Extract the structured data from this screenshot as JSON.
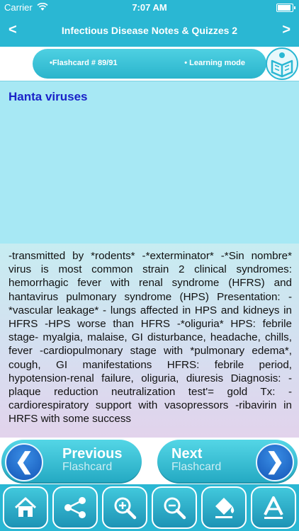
{
  "status_bar": {
    "carrier": "Carrier",
    "time": "7:07 AM"
  },
  "nav": {
    "title": "Infectious Disease Notes & Quizzes 2",
    "back_glyph": "<",
    "forward_glyph": ">"
  },
  "info": {
    "flashcard": "•Flashcard #  89/91",
    "mode": "• Learning mode"
  },
  "card": {
    "title": "Hanta viruses",
    "body": "-transmitted by *rodents* -*exterminator* -*Sin nombre* virus is most common strain   2 clinical syndromes: hemorrhagic fever with renal syndrome (HFRS) and hantavirus pulmonary syndrome (HPS)  Presentation: -*vascular leakage* - lungs affected in HPS and kidneys in HFRS -HPS worse than HFRS -*oliguria*  HPS: febrile stage- myalgia, malaise, GI disturbance, headache, chills, fever -cardiopulmonary stage with *pulmonary edema*, cough, GI manifestations  HFRS: febrile period, hypotension-renal failure, oliguria, diuresis    Diagnosis: -plaque reduction neutralization test'= gold    Tx: -cardiorespiratory support with vasopressors -ribavirin in HRFS with some success"
  },
  "navigation": {
    "prev_line1": "Previous",
    "prev_line2": "Flashcard",
    "next_line1": "Next",
    "next_line2": "Flashcard"
  },
  "toolbar": {
    "icons": [
      "home-icon",
      "share-icon",
      "zoom-in-icon",
      "zoom-out-icon",
      "paint-bucket-icon",
      "font-icon"
    ]
  },
  "colors": {
    "primary": "#2ab7d3",
    "title_text": "#1a23c8",
    "title_bg": "#a7e8f4",
    "nav_circle": "#1f6fd0"
  }
}
